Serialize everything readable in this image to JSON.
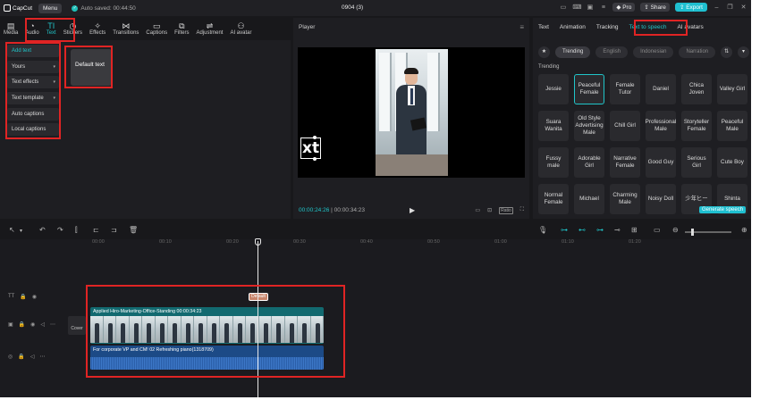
{
  "app": {
    "name": "CapCut",
    "menu_label": "Menu",
    "autosave": "Auto saved: 00:44:50",
    "project_title": "0904 (3)",
    "pro_label": "Pro",
    "share_label": "Share",
    "export_label": "Export"
  },
  "toolbar": {
    "items": [
      {
        "label": "Media",
        "icon": "media-icon"
      },
      {
        "label": "Audio",
        "icon": "audio-icon"
      },
      {
        "label": "Text",
        "icon": "text-icon"
      },
      {
        "label": "Stickers",
        "icon": "stickers-icon"
      },
      {
        "label": "Effects",
        "icon": "effects-icon"
      },
      {
        "label": "Transitions",
        "icon": "transitions-icon"
      },
      {
        "label": "Captions",
        "icon": "captions-icon"
      },
      {
        "label": "Filters",
        "icon": "filters-icon"
      },
      {
        "label": "Adjustment",
        "icon": "adjustment-icon"
      },
      {
        "label": "AI avatar",
        "icon": "ai-avatar-icon"
      }
    ]
  },
  "text_panel": {
    "sidebar": [
      "Add text",
      "Yours",
      "Text effects",
      "Text template",
      "Auto captions",
      "Local captions"
    ],
    "default_text": "Default text"
  },
  "player": {
    "title": "Player",
    "overlay_text": "xt",
    "current_time": "00:00:24:26",
    "total_time": "00:00:34:23",
    "ratio_label": "Ratio"
  },
  "right_panel": {
    "tabs": [
      "Text",
      "Animation",
      "Tracking",
      "Text to speech",
      "AI avatars"
    ],
    "filters": [
      "Trending",
      "English",
      "Indonesian",
      "Narration"
    ],
    "section_label": "Trending",
    "voices": [
      "Jessie",
      "Peaceful Female",
      "Female Tutor",
      "Daniel",
      "Chica Joven",
      "Valley Girl",
      "Suara Wanita",
      "Old Style Advertising Male",
      "Chill Girl",
      "Professional Male",
      "Storyteller Female",
      "Peaceful Male",
      "Fussy male",
      "Adorable Girl",
      "Narrative Female",
      "Good Guy",
      "Serious Girl",
      "Cute Boy",
      "Normal Female",
      "Michael",
      "Charming Male",
      "Noisy Doll",
      "少年ヒー",
      "Shinta"
    ],
    "generate_label": "Generate speech"
  },
  "timeline": {
    "ruler": [
      "00:00",
      "00:10",
      "00:20",
      "00:30",
      "00:40",
      "00:50",
      "01:00",
      "01:10",
      "01:20"
    ],
    "text_clip": "Default",
    "video_clip": "Applied   Hiro-Marketing-Office-Standing   00:00:34:23",
    "audio_clip": "For corporate VP and CM! 02 Refreshing piano(1318709)",
    "cover_label": "Cover"
  },
  "accent_color": "#20c5c9",
  "highlight_color": "#e02424"
}
